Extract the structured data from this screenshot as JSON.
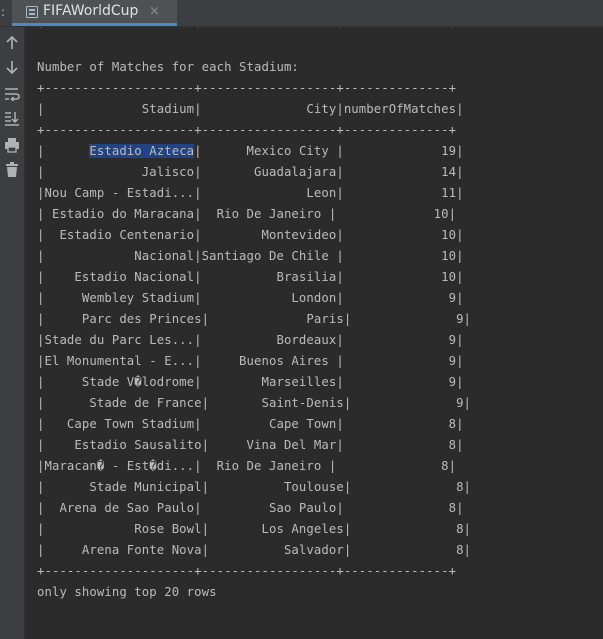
{
  "tab": {
    "prefix": ":",
    "title": "FIFAWorldCup",
    "close_glyph": "×"
  },
  "toolbar": {
    "tools": [
      "up-arrow-icon",
      "down-arrow-icon",
      "soft-wrap-icon",
      "scroll-to-end-icon",
      "print-icon",
      "trash-icon"
    ]
  },
  "console": {
    "top_border": "+--------------------+------------------+--------------+",
    "heading": "Number of Matches for each Stadium:",
    "border": "+--------------------+------------------+--------------+",
    "header_row": "|             Stadium|              City|numberOfMatches|",
    "rows": [
      {
        "pre": "|      ",
        "selected": "Estadio Azteca",
        "post": "|      Mexico City |             19|"
      },
      {
        "text": "|             Jalisco|       Guadalajara|             14|"
      },
      {
        "text": "|Nou Camp - Estadi...|              Leon|             11|"
      },
      {
        "text": "| Estadio do Maracana|  Rio De Janeiro |             10|"
      },
      {
        "text": "|  Estadio Centenario|        Montevideo|             10|"
      },
      {
        "text": "|            Nacional|Santiago De Chile |             10|"
      },
      {
        "text": "|    Estadio Nacional|          Brasilia|             10|"
      },
      {
        "text": "|     Wembley Stadium|            London|              9|"
      },
      {
        "text": "|     Parc des Princes|             Paris|              9|"
      },
      {
        "text": "|Stade du Parc Les...|          Bordeaux|              9|"
      },
      {
        "text": "|El Monumental - E...|     Buenos Aires |              9|"
      },
      {
        "text": "|     Stade V�lodrome|        Marseilles|              9|"
      },
      {
        "text": "|      Stade de France|       Saint-Denis|              9|"
      },
      {
        "text": "|   Cape Town Stadium|         Cape Town|              8|"
      },
      {
        "text": "|    Estadio Sausalito|     Vina Del Mar|              8|"
      },
      {
        "text": "|Maracan� - Est�di...|  Rio De Janeiro |              8|"
      },
      {
        "text": "|      Stade Municipal|          Toulouse|              8|"
      },
      {
        "text": "|  Arena de Sao Paulo|         Sao Paulo|              8|"
      },
      {
        "text": "|            Rose Bowl|       Los Angeles|              8|"
      },
      {
        "text": "|     Arena Fonte Nova|          Salvador|              8|"
      }
    ],
    "bottom_border": "+--------------------+------------------+--------------+",
    "footer": "only showing top 20 rows"
  },
  "colors": {
    "background": "#2b2b2b",
    "panel": "#3c3f41",
    "text": "#bbbbbb",
    "selection": "#214283",
    "tab_underline": "#4a88c7"
  }
}
